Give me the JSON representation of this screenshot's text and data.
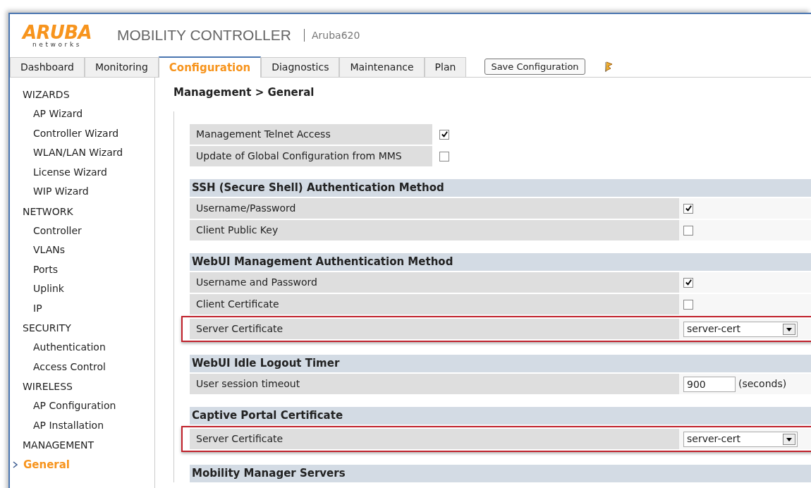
{
  "logo": {
    "brand": "ARUBA",
    "sub": "networks"
  },
  "header": {
    "product": "MOBILITY CONTROLLER",
    "device": "Aruba620"
  },
  "tabs": [
    {
      "label": "Dashboard",
      "selected": false
    },
    {
      "label": "Monitoring",
      "selected": false
    },
    {
      "label": "Configuration",
      "selected": true
    },
    {
      "label": "Diagnostics",
      "selected": false
    },
    {
      "label": "Maintenance",
      "selected": false
    },
    {
      "label": "Plan",
      "selected": false
    }
  ],
  "save_button": "Save Configuration",
  "sidebar": [
    {
      "heading": "WIZARDS",
      "items": [
        {
          "label": "AP Wizard",
          "selected": false
        },
        {
          "label": "Controller Wizard",
          "selected": false
        },
        {
          "label": "WLAN/LAN Wizard",
          "selected": false
        },
        {
          "label": "License Wizard",
          "selected": false
        },
        {
          "label": "WIP Wizard",
          "selected": false
        }
      ]
    },
    {
      "heading": "NETWORK",
      "items": [
        {
          "label": "Controller",
          "selected": false
        },
        {
          "label": "VLANs",
          "selected": false
        },
        {
          "label": "Ports",
          "selected": false
        },
        {
          "label": "Uplink",
          "selected": false
        },
        {
          "label": "IP",
          "selected": false
        }
      ]
    },
    {
      "heading": "SECURITY",
      "items": [
        {
          "label": "Authentication",
          "selected": false
        },
        {
          "label": "Access Control",
          "selected": false
        }
      ]
    },
    {
      "heading": "WIRELESS",
      "items": [
        {
          "label": "AP Configuration",
          "selected": false
        },
        {
          "label": "AP Installation",
          "selected": false
        }
      ]
    },
    {
      "heading": "MANAGEMENT",
      "items": [
        {
          "label": "General",
          "selected": true
        }
      ]
    }
  ],
  "breadcrumb": "Management > General",
  "top_rows": [
    {
      "label": "Management Telnet Access",
      "checked": true
    },
    {
      "label": "Update of Global Configuration from MMS",
      "checked": false
    }
  ],
  "sections": [
    {
      "title": "SSH (Secure Shell) Authentication Method",
      "rows": [
        {
          "kind": "checkbox",
          "label": "Username/Password",
          "checked": true,
          "highlighted": false
        },
        {
          "kind": "checkbox",
          "label": "Client Public Key",
          "checked": false,
          "highlighted": false
        }
      ]
    },
    {
      "title": "WebUI Management Authentication Method",
      "rows": [
        {
          "kind": "checkbox",
          "label": "Username and Password",
          "checked": true,
          "highlighted": false
        },
        {
          "kind": "checkbox",
          "label": "Client Certificate",
          "checked": false,
          "highlighted": false
        },
        {
          "kind": "select",
          "label": "Server Certificate",
          "value": "server-cert",
          "highlighted": true
        }
      ]
    },
    {
      "title": "WebUI Idle Logout Timer",
      "rows": [
        {
          "kind": "number",
          "label": "User session timeout",
          "value": "900",
          "unit": "(seconds)",
          "highlighted": false
        }
      ]
    },
    {
      "title": "Captive Portal Certificate",
      "rows": [
        {
          "kind": "select",
          "label": "Server Certificate",
          "value": "server-cert",
          "highlighted": true
        }
      ]
    },
    {
      "title": "Mobility Manager Servers"
    }
  ]
}
